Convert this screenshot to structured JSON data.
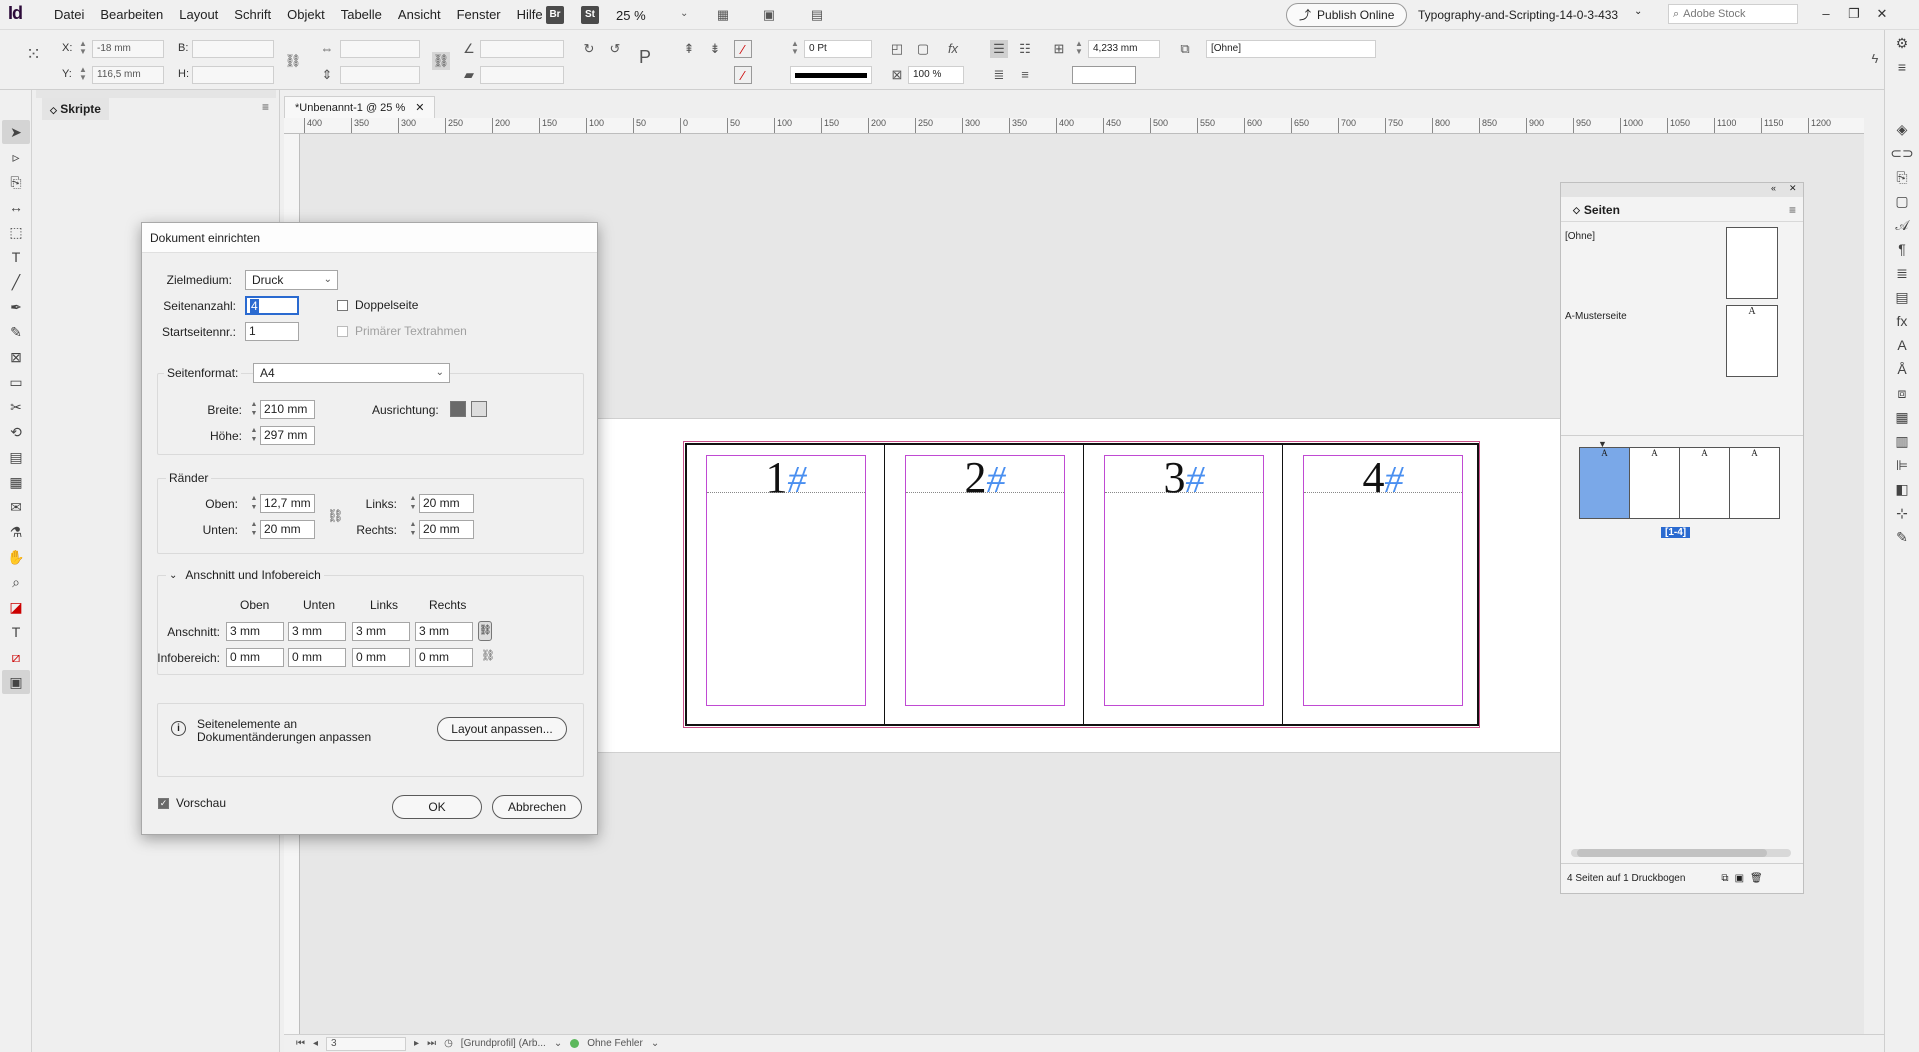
{
  "app": {
    "logo": "Id",
    "menus": [
      "Datei",
      "Bearbeiten",
      "Layout",
      "Schrift",
      "Objekt",
      "Tabelle",
      "Ansicht",
      "Fenster",
      "Hilfe"
    ],
    "bridge_badge": "Br",
    "stock_badge": "St",
    "zoom": "25 %",
    "publish_online": "Publish Online",
    "workspace": "Typography-and-Scripting-14-0-3-433",
    "search_placeholder": "Adobe Stock"
  },
  "controlbar": {
    "x_label": "X:",
    "x_value": "-18 mm",
    "y_label": "Y:",
    "y_value": "116,5 mm",
    "b_label": "B:",
    "h_label": "H:",
    "stroke_weight": "0 Pt",
    "opacity": "100 %",
    "size_value": "4,233 mm",
    "object_style": "[Ohne]"
  },
  "scripts_panel": {
    "tab": "Skripte"
  },
  "document": {
    "tab_title": "*Unbenannt-1 @ 25 %",
    "ruler_ticks": [
      "400",
      "350",
      "300",
      "250",
      "200",
      "150",
      "100",
      "50",
      "0",
      "50",
      "100",
      "150",
      "200",
      "250",
      "300",
      "350",
      "400",
      "450",
      "500",
      "550",
      "600",
      "650",
      "700",
      "750",
      "800",
      "850",
      "900",
      "950",
      "1000",
      "1050",
      "1100",
      "1150",
      "1200"
    ],
    "pages": [
      {
        "num": "1",
        "hash": "#"
      },
      {
        "num": "2",
        "hash": "#"
      },
      {
        "num": "3",
        "hash": "#"
      },
      {
        "num": "4",
        "hash": "#"
      }
    ]
  },
  "statusbar": {
    "page_field": "3",
    "profile": "[Grundprofil] (Arb...",
    "preflight": "Ohne Fehler"
  },
  "pages_panel": {
    "tab": "Seiten",
    "none_label": "[Ohne]",
    "master_label": "A-Musterseite",
    "master_letter": "A",
    "spread_label": "[1-4]",
    "footer_text": "4 Seiten auf 1 Druckbogen"
  },
  "dialog": {
    "title": "Dokument einrichten",
    "intent_label": "Zielmedium:",
    "intent_value": "Druck",
    "pages_label": "Seitenanzahl:",
    "pages_value": "4",
    "facing_label": "Doppelseite",
    "start_label": "Startseitennr.:",
    "start_value": "1",
    "primary_frame_label": "Primärer Textrahmen",
    "size_label": "Seitenformat:",
    "size_value": "A4",
    "width_label": "Breite:",
    "width_value": "210 mm",
    "height_label": "Höhe:",
    "height_value": "297 mm",
    "orientation_label": "Ausrichtung:",
    "margins_title": "Ränder",
    "top_label": "Oben:",
    "top_value": "12,7 mm",
    "bottom_label": "Unten:",
    "bottom_value": "20 mm",
    "left_label": "Links:",
    "left_value": "20 mm",
    "right_label": "Rechts:",
    "right_value": "20 mm",
    "bleed_title": "Anschnitt und Infobereich",
    "col_top": "Oben",
    "col_bottom": "Unten",
    "col_left": "Links",
    "col_right": "Rechts",
    "bleed_label": "Anschnitt:",
    "bleed_values": [
      "3 mm",
      "3 mm",
      "3 mm",
      "3 mm"
    ],
    "slug_label": "Infobereich:",
    "slug_values": [
      "0 mm",
      "0 mm",
      "0 mm",
      "0 mm"
    ],
    "adjust_info": "Seitenelemente an Dokumentänderungen anpassen",
    "adjust_button": "Layout anpassen...",
    "preview_label": "Vorschau",
    "ok": "OK",
    "cancel": "Abbrechen"
  },
  "colors": {
    "accent": "#4a8ff0",
    "margin_guide": "#c04ad3",
    "bleed_guide": "#c8508a",
    "selected_page": "#7aa8e8"
  }
}
